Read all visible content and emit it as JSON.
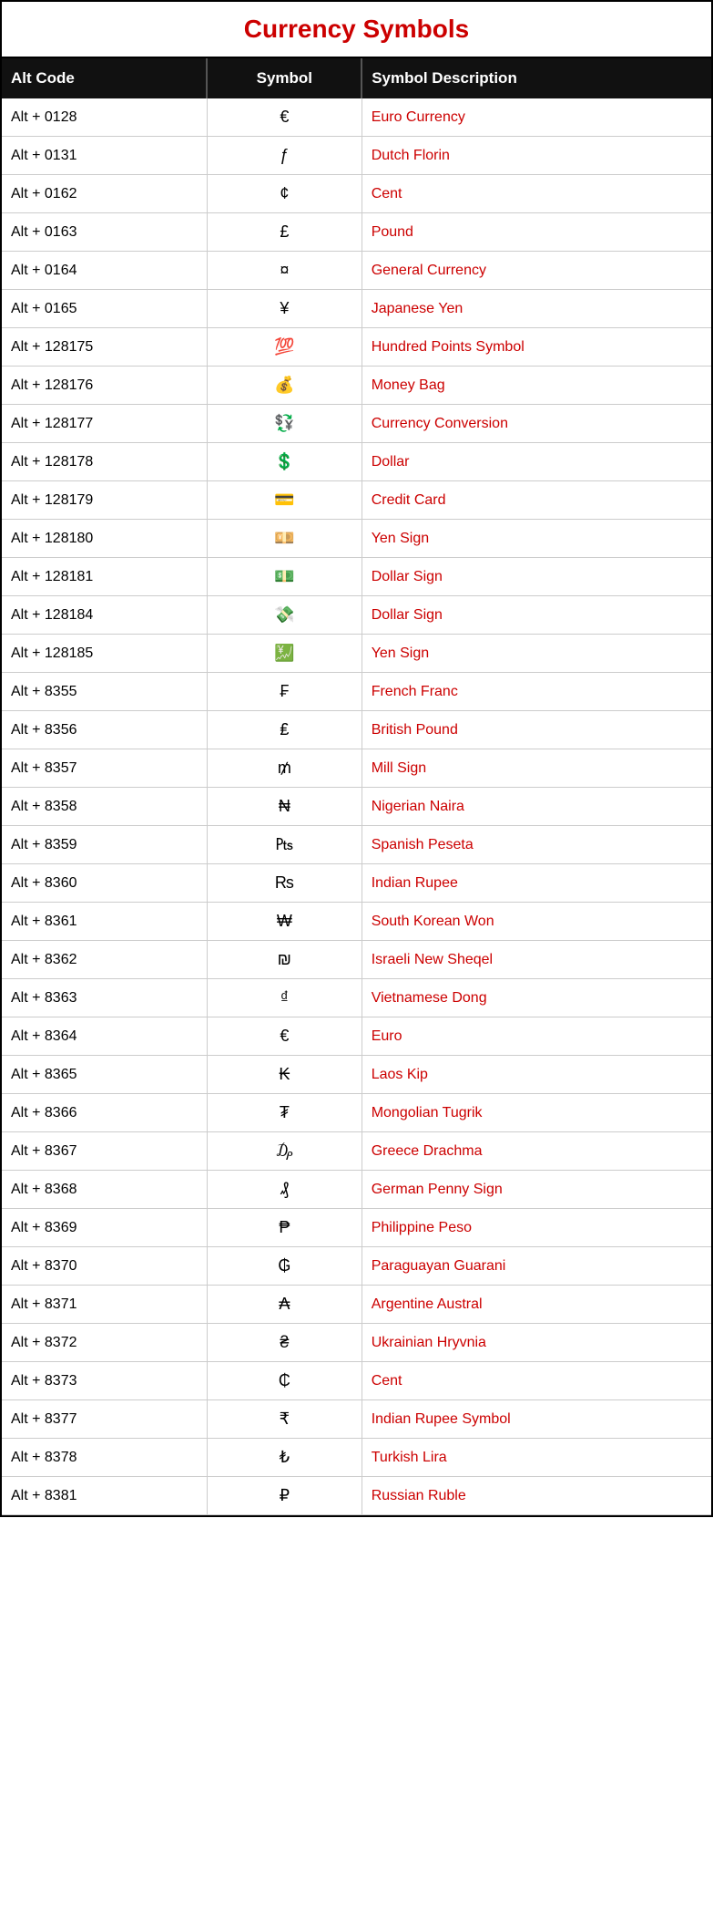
{
  "page": {
    "title": "Currency Symbols"
  },
  "headers": [
    {
      "label": "Alt Code"
    },
    {
      "label": "Symbol"
    },
    {
      "label": "Symbol Description"
    }
  ],
  "rows": [
    {
      "alt_code": "Alt + 0128",
      "symbol": "€",
      "description": "Euro Currency"
    },
    {
      "alt_code": "Alt + 0131",
      "symbol": "ƒ",
      "description": "Dutch Florin"
    },
    {
      "alt_code": "Alt + 0162",
      "symbol": "¢",
      "description": "Cent"
    },
    {
      "alt_code": "Alt + 0163",
      "symbol": "£",
      "description": "Pound"
    },
    {
      "alt_code": "Alt + 0164",
      "symbol": "¤",
      "description": "General Currency"
    },
    {
      "alt_code": "Alt + 0165",
      "symbol": "¥",
      "description": "Japanese Yen"
    },
    {
      "alt_code": "Alt + 128175",
      "symbol": "💯",
      "description": "Hundred Points Symbol"
    },
    {
      "alt_code": "Alt + 128176",
      "symbol": "💰",
      "description": "Money Bag"
    },
    {
      "alt_code": "Alt + 128177",
      "symbol": "💱",
      "description": "Currency Conversion"
    },
    {
      "alt_code": "Alt + 128178",
      "symbol": "💲",
      "description": "Dollar"
    },
    {
      "alt_code": "Alt + 128179",
      "symbol": "💳",
      "description": "Credit Card"
    },
    {
      "alt_code": "Alt + 128180",
      "symbol": "💴",
      "description": "Yen Sign"
    },
    {
      "alt_code": "Alt + 128181",
      "symbol": "💵",
      "description": "Dollar Sign"
    },
    {
      "alt_code": "Alt + 128184",
      "symbol": "💸",
      "description": "Dollar Sign"
    },
    {
      "alt_code": "Alt + 128185",
      "symbol": "💹",
      "description": "Yen Sign"
    },
    {
      "alt_code": "Alt + 8355",
      "symbol": "₣",
      "description": "French Franc"
    },
    {
      "alt_code": "Alt + 8356",
      "symbol": "₤",
      "description": "British Pound"
    },
    {
      "alt_code": "Alt + 8357",
      "symbol": "₥",
      "description": "Mill Sign"
    },
    {
      "alt_code": "Alt + 8358",
      "symbol": "₦",
      "description": "Nigerian Naira"
    },
    {
      "alt_code": "Alt + 8359",
      "symbol": "₧",
      "description": "Spanish Peseta"
    },
    {
      "alt_code": "Alt + 8360",
      "symbol": "₨",
      "description": "Indian Rupee"
    },
    {
      "alt_code": "Alt + 8361",
      "symbol": "₩",
      "description": "South Korean Won"
    },
    {
      "alt_code": "Alt + 8362",
      "symbol": "₪",
      "description": "Israeli New Sheqel"
    },
    {
      "alt_code": "Alt + 8363",
      "symbol": "₫",
      "description": "Vietnamese Dong"
    },
    {
      "alt_code": "Alt + 8364",
      "symbol": "€",
      "description": "Euro"
    },
    {
      "alt_code": "Alt + 8365",
      "symbol": "₭",
      "description": "Laos Kip"
    },
    {
      "alt_code": "Alt + 8366",
      "symbol": "₮",
      "description": "Mongolian Tugrik"
    },
    {
      "alt_code": "Alt + 8367",
      "symbol": "₯",
      "description": "Greece Drachma"
    },
    {
      "alt_code": "Alt + 8368",
      "symbol": "₰",
      "description": "German Penny  Sign"
    },
    {
      "alt_code": "Alt + 8369",
      "symbol": "₱",
      "description": "Philippine Peso"
    },
    {
      "alt_code": "Alt + 8370",
      "symbol": "₲",
      "description": "Paraguayan Guarani"
    },
    {
      "alt_code": "Alt + 8371",
      "symbol": "₳",
      "description": "Argentine Austral"
    },
    {
      "alt_code": "Alt + 8372",
      "symbol": "₴",
      "description": "Ukrainian Hryvnia"
    },
    {
      "alt_code": "Alt + 8373",
      "symbol": "₵",
      "description": "Cent"
    },
    {
      "alt_code": "Alt + 8377",
      "symbol": "₹",
      "description": "Indian Rupee Symbol"
    },
    {
      "alt_code": "Alt + 8378",
      "symbol": "₺",
      "description": "Turkish Lira"
    },
    {
      "alt_code": "Alt + 8381",
      "symbol": "₽",
      "description": "Russian Ruble"
    }
  ]
}
